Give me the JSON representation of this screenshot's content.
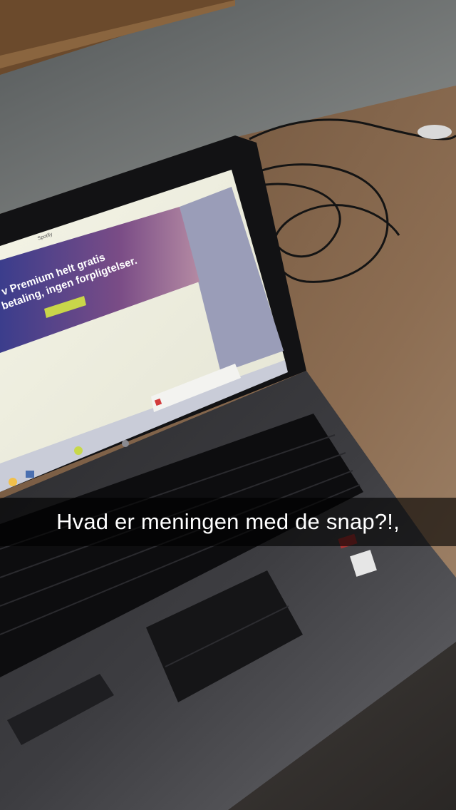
{
  "caption": {
    "text": "Hvad er meningen med de snap?!,"
  },
  "screen": {
    "window_title": "Spotify",
    "banner_line_1": "v Premium helt gratis",
    "banner_line_2": "betaling, ingen forpligtelser."
  },
  "colors": {
    "caption_bar": "#000000",
    "caption_text": "#ffffff"
  }
}
